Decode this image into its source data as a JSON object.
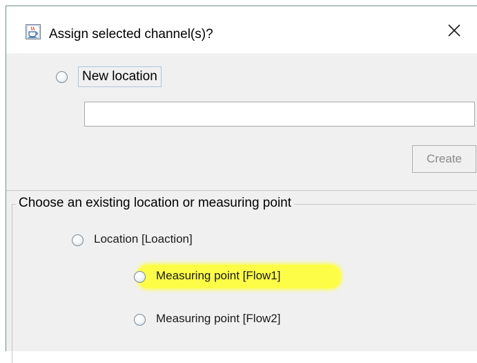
{
  "window": {
    "title": "Assign selected channel(s)?",
    "app_icon": "java-cup-icon",
    "close_icon": "close-icon",
    "close_symbol": "✕"
  },
  "new_location": {
    "radio_label": "New location",
    "input_value": "",
    "create_label": "Create",
    "create_enabled": false
  },
  "existing": {
    "group_title": "Choose an existing location or measuring point",
    "options": [
      {
        "label": "Location [Loaction]",
        "selected": false
      },
      {
        "label": "Measuring point [Flow1]",
        "selected": false,
        "highlighted": true
      },
      {
        "label": "Measuring point [Flow2]",
        "selected": false
      }
    ]
  },
  "colors": {
    "dialog_bg": "#f0f0f0",
    "highlight": "#ffff3a",
    "focus_border": "#b0c4dc",
    "disabled_text": "#8a8a8a"
  }
}
